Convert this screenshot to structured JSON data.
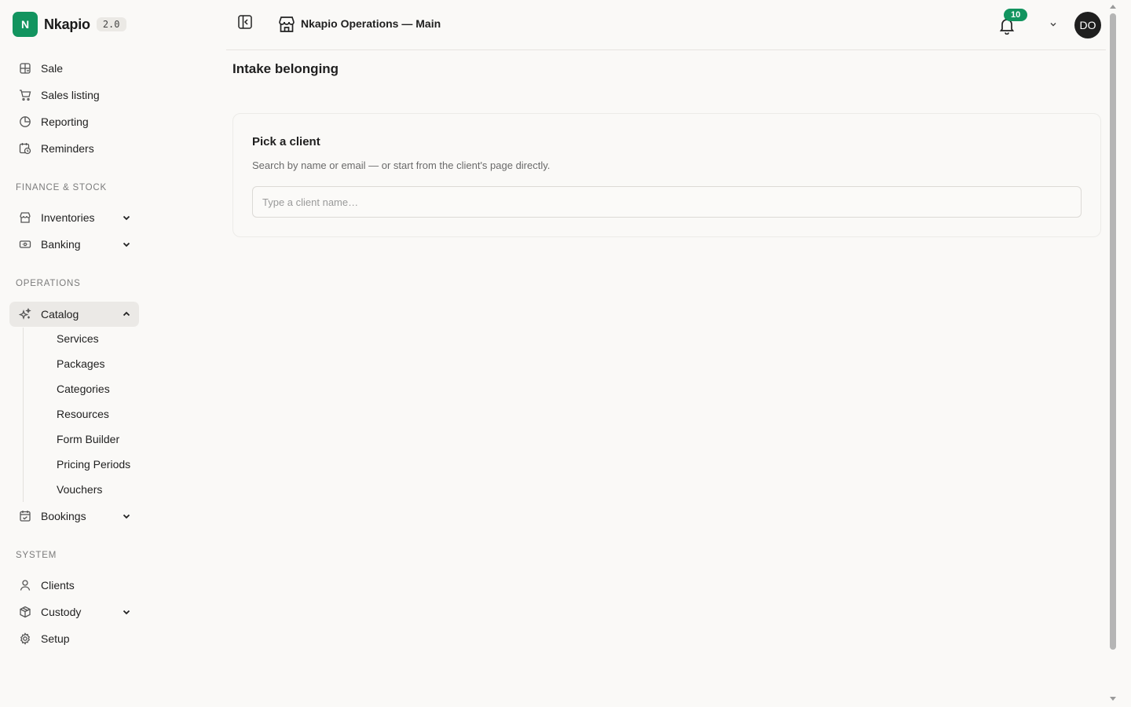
{
  "brand": {
    "logo_letter": "N",
    "name": "Nkapio",
    "version": "2.0"
  },
  "colors": {
    "accent": "#12945f",
    "text": "#1f1f1f",
    "muted": "#7b7b7b",
    "active_bg": "#ebe9e6"
  },
  "sidebar": {
    "top_items": [
      {
        "label": "Sale",
        "icon": "register-icon"
      },
      {
        "label": "Sales listing",
        "icon": "cart-icon"
      },
      {
        "label": "Reporting",
        "icon": "pie-chart-icon"
      },
      {
        "label": "Reminders",
        "icon": "calendar-clock-icon"
      }
    ],
    "sections": {
      "finance": "FINANCE & STOCK",
      "operations": "OPERATIONS",
      "system": "SYSTEM"
    },
    "finance_items": [
      {
        "label": "Inventories",
        "icon": "store-icon"
      },
      {
        "label": "Banking",
        "icon": "banknote-icon"
      }
    ],
    "operations_items": {
      "catalog": {
        "label": "Catalog",
        "icon": "sparkles-icon"
      },
      "catalog_children": [
        "Services",
        "Packages",
        "Categories",
        "Resources",
        "Form Builder",
        "Pricing Periods",
        "Vouchers"
      ],
      "bookings": {
        "label": "Bookings",
        "icon": "calendar-check-icon"
      }
    },
    "system_items": [
      {
        "label": "Clients",
        "icon": "user-icon"
      },
      {
        "label": "Custody",
        "icon": "package-icon"
      },
      {
        "label": "Setup",
        "icon": "gear-icon"
      }
    ]
  },
  "topbar": {
    "org_name": "Nkapio Operations — Main",
    "notification_count": "10",
    "avatar_initials": "DO"
  },
  "main": {
    "title": "Intake belonging",
    "card": {
      "title": "Pick a client",
      "description": "Search by name or email — or start from the client's page directly.",
      "input_placeholder": "Type a client name…",
      "input_value": ""
    }
  }
}
